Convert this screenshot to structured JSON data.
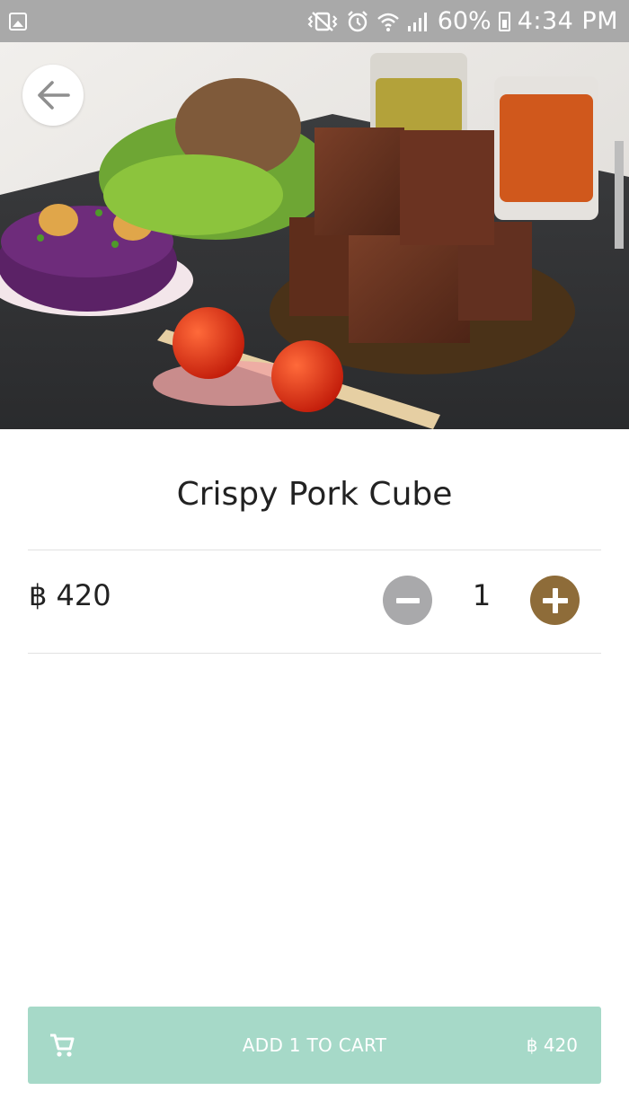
{
  "status_bar": {
    "battery": "60%",
    "time": "4:34 PM",
    "icons": [
      "gallery-icon",
      "vibrate-icon",
      "alarm-icon",
      "wifi-icon",
      "signal-icon",
      "battery-charging-icon"
    ]
  },
  "hero": {
    "image": "crispy-pork-cube-dish-photo",
    "back_icon": "arrow-left-icon"
  },
  "product": {
    "title": "Crispy Pork Cube",
    "price": "฿ 420",
    "quantity": "1"
  },
  "cart": {
    "icon": "shopping-cart-icon",
    "label": "ADD 1 TO CART",
    "total": "฿ 420"
  },
  "colors": {
    "status_bar": "#a9a9a9",
    "minus_button": "#a9a9ab",
    "plus_button": "#8e6c39",
    "cart_button": "#a6d9c8"
  }
}
